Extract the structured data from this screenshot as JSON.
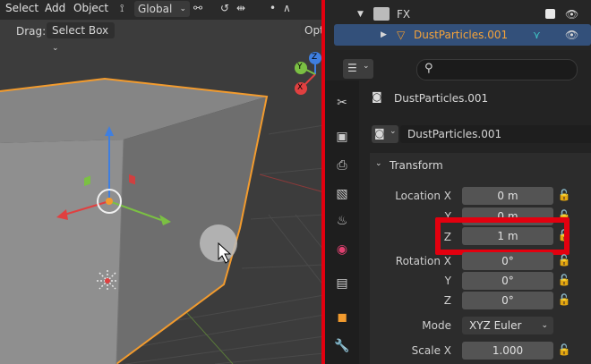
{
  "viewport": {
    "menu": [
      "Select",
      "Add",
      "Object"
    ],
    "orientation": "Global",
    "drag_label": "Drag:",
    "drag_value": "Select Box",
    "options_label": "Opti",
    "gizmo": {
      "x": "X",
      "y": "Y",
      "z": "Z"
    }
  },
  "outliner": {
    "collection": "FX",
    "object": "DustParticles.001"
  },
  "properties": {
    "object_name": "DustParticles.001",
    "datablock_name": "DustParticles.001",
    "panel_title": "Transform",
    "location": {
      "label": "Location X",
      "x": "0 m",
      "y_label": "Y",
      "y": "0 m",
      "z_label": "Z",
      "z": "1 m"
    },
    "rotation": {
      "label": "Rotation X",
      "x": "0°",
      "y_label": "Y",
      "y": "0°",
      "z_label": "Z",
      "z": "0°"
    },
    "mode_label": "Mode",
    "mode_value": "XYZ Euler",
    "scale": {
      "label": "Scale X",
      "x": "1.000"
    }
  },
  "colors": {
    "highlight": "#e3000f",
    "selection_outline": "#f29b2e",
    "active_text": "#f5a33a"
  }
}
